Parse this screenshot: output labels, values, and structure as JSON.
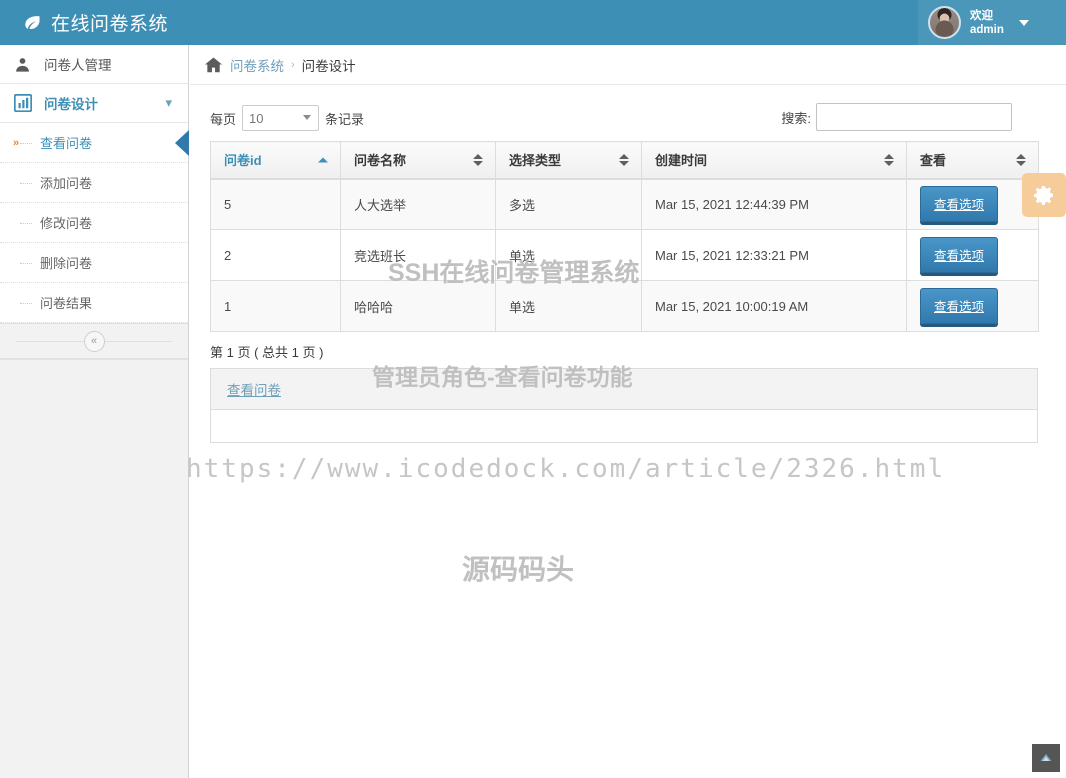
{
  "topbar": {
    "brand": "在线问卷系统",
    "brand_icon": "leaf-icon",
    "user": {
      "greeting": "欢迎",
      "name": "admin",
      "avatar_icon": "user-avatar",
      "caret_icon": "caret-down-icon"
    }
  },
  "sidebar": {
    "items": [
      {
        "label": "问卷人管理",
        "icon": "user-icon",
        "active": false
      },
      {
        "label": "问卷设计",
        "icon": "chart-bar-icon",
        "active": true,
        "chevron": "chevron-down-icon"
      }
    ],
    "submenu": [
      {
        "label": "查看问卷",
        "active": true,
        "bullet": "»"
      },
      {
        "label": "添加问卷",
        "active": false
      },
      {
        "label": "修改问卷",
        "active": false
      },
      {
        "label": "删除问卷",
        "active": false
      },
      {
        "label": "问卷结果",
        "active": false
      }
    ],
    "collapse_label": "«"
  },
  "breadcrumb": {
    "home_icon": "home-icon",
    "root": "问卷系统",
    "separator": "›",
    "current": "问卷设计"
  },
  "toolbar": {
    "length_prefix": "每页",
    "length_value": "10",
    "length_suffix": "条记录",
    "search_label": "搜索:",
    "search_value": "",
    "search_placeholder": "",
    "gear_icon": "gear-icon"
  },
  "table": {
    "columns": [
      {
        "label": "问卷id",
        "sort": "asc"
      },
      {
        "label": "问卷名称",
        "sort": "none"
      },
      {
        "label": "选择类型",
        "sort": "none"
      },
      {
        "label": "创建时间",
        "sort": "none"
      },
      {
        "label": "查看",
        "sort": "none"
      }
    ],
    "rows": [
      {
        "id": "5",
        "name": "人大选举",
        "type": "多选",
        "created": "Mar 15, 2021 12:44:39 PM",
        "action": "查看选项"
      },
      {
        "id": "2",
        "name": "竞选班长",
        "type": "单选",
        "created": "Mar 15, 2021 12:33:21 PM",
        "action": "查看选项"
      },
      {
        "id": "1",
        "name": "哈哈哈",
        "type": "单选",
        "created": "Mar 15, 2021 10:00:19 AM",
        "action": "查看选项"
      }
    ]
  },
  "pagination": {
    "text": "第 1 页 ( 总共 1 页 )"
  },
  "subpanel": {
    "title": "查看问卷"
  },
  "watermarks": {
    "w1": "SSH在线问卷管理系统",
    "w2": "管理员角色-查看问卷功能",
    "w3": "https://www.icodedock.com/article/2326.html",
    "w4": "源码码头"
  },
  "scroll_top": {
    "icon": "arrow-up-icon"
  },
  "colors": {
    "brand_blue": "#3e8fb5",
    "button_blue": "#3179ac",
    "gear_orange": "#f6cc9a",
    "link_blue": "#6f9fbb",
    "watermark_gray": "#c0c0c0"
  }
}
